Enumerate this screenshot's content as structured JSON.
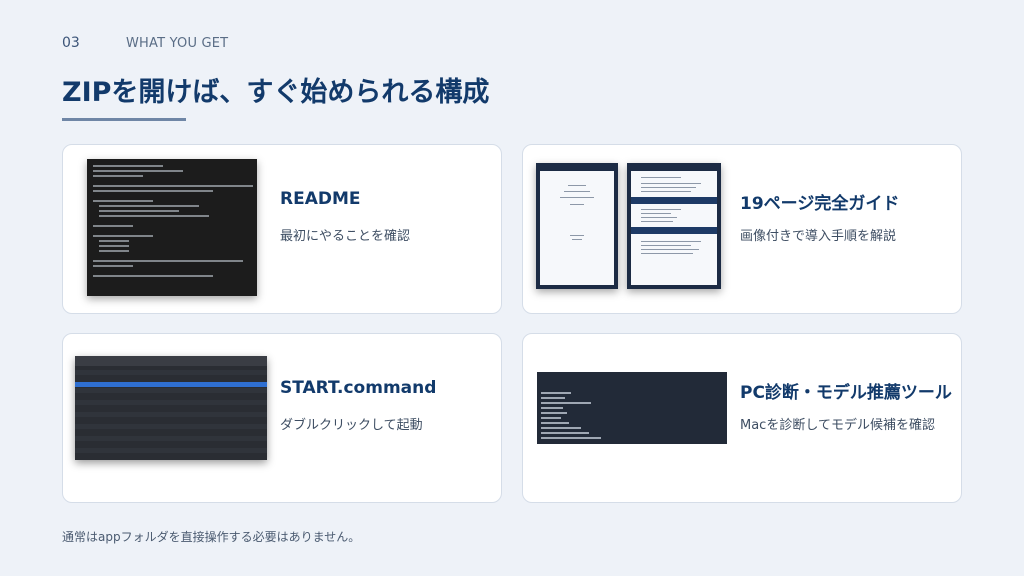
{
  "header": {
    "slide_number": "03",
    "eyebrow": "WHAT YOU GET",
    "title": "ZIPを開けば、すぐ始められる構成"
  },
  "cards": [
    {
      "title": "README",
      "description": "最初にやることを確認"
    },
    {
      "title": "19ページ完全ガイド",
      "description": "画像付きで導入手順を解説"
    },
    {
      "title": "START.command",
      "description": "ダブルクリックして起動"
    },
    {
      "title": "PC診断・モデル推薦ツール",
      "description": "Macを診断してモデル候補を確認"
    }
  ],
  "footnote": "通常はappフォルダを直接操作する必要はありません。",
  "colors": {
    "background": "#eef2f8",
    "title": "#123a6b",
    "card": "#ffffff",
    "accent_line": "#6f86a6"
  }
}
